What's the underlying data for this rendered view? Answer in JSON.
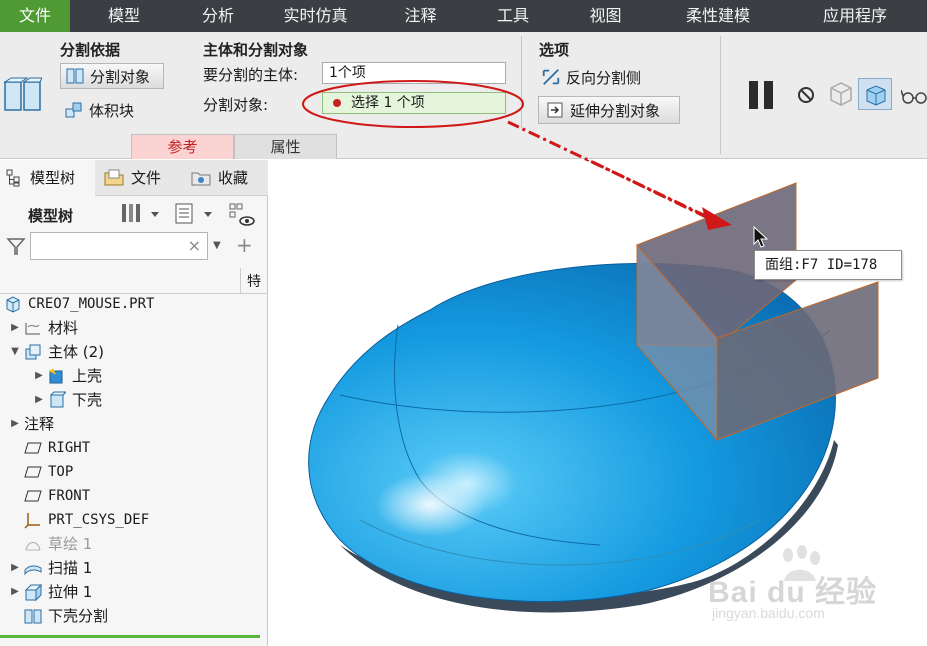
{
  "menu": [
    "文件",
    "模型",
    "分析",
    "实时仿真",
    "注释",
    "工具",
    "视图",
    "柔性建模",
    "应用程序"
  ],
  "ribbon": {
    "split_basis_title": "分割依据",
    "split_object_btn": "分割对象",
    "volume_block_btn": "体积块",
    "main_title": "主体和分割对象",
    "body_label": "要分割的主体:",
    "body_value": "1个项",
    "object_label": "分割对象:",
    "object_value": "选择 1 个项",
    "options_title": "选项",
    "reverse_side": "反向分割侧",
    "extend_object": "延伸分割对象",
    "tab_reference": "参考",
    "tab_properties": "属性"
  },
  "panel": {
    "tabs": [
      "模型树",
      "文件",
      "收藏"
    ],
    "tree_title": "模型树",
    "side_label": "特",
    "search_placeholder": "",
    "tree": [
      {
        "label": "CREO7_MOUSE.PRT",
        "icon": "part-icon",
        "indent": 0,
        "toggle": "",
        "mono": true,
        "dim": false
      },
      {
        "label": "材料",
        "icon": "material-icon",
        "indent": 1,
        "toggle": "▶",
        "mono": false,
        "dim": false
      },
      {
        "label": "主体 (2)",
        "icon": "bodies-icon",
        "indent": 1,
        "toggle": "▼",
        "mono": false,
        "dim": false
      },
      {
        "label": "上壳",
        "icon": "body-active-icon",
        "indent": 2,
        "toggle": "▶",
        "mono": false,
        "dim": false
      },
      {
        "label": "下壳",
        "icon": "body-icon",
        "indent": 2,
        "toggle": "▶",
        "mono": false,
        "dim": false
      },
      {
        "label": "注释",
        "icon": "",
        "indent": 1,
        "toggle": "▶",
        "mono": false,
        "dim": false
      },
      {
        "label": "RIGHT",
        "icon": "datum-plane-icon",
        "indent": 1,
        "toggle": "",
        "mono": true,
        "dim": false
      },
      {
        "label": "TOP",
        "icon": "datum-plane-icon",
        "indent": 1,
        "toggle": "",
        "mono": true,
        "dim": false
      },
      {
        "label": "FRONT",
        "icon": "datum-plane-icon",
        "indent": 1,
        "toggle": "",
        "mono": true,
        "dim": false
      },
      {
        "label": "PRT_CSYS_DEF",
        "icon": "csys-icon",
        "indent": 1,
        "toggle": "",
        "mono": true,
        "dim": false
      },
      {
        "label": "草绘 1",
        "icon": "sketch-icon",
        "indent": 1,
        "toggle": "",
        "mono": false,
        "dim": true
      },
      {
        "label": "扫描 1",
        "icon": "sweep-icon",
        "indent": 1,
        "toggle": "▶",
        "mono": false,
        "dim": false
      },
      {
        "label": "拉伸 1",
        "icon": "extrude-icon",
        "indent": 1,
        "toggle": "▶",
        "mono": false,
        "dim": false
      },
      {
        "label": "下壳分割",
        "icon": "split-icon",
        "indent": 1,
        "toggle": "",
        "mono": false,
        "dim": false
      }
    ]
  },
  "viewport": {
    "tooltip": "面组:F7 ID=178"
  },
  "watermark": {
    "brand": "Bai du 经验",
    "url": "jingyan.baidu.com"
  },
  "colors": {
    "menubar": "#3b3f44",
    "active_menu": "#4f9a32",
    "model_blue": "#1a9be0",
    "quilt_gray": "#6b6a78",
    "annotation_red": "#d01818"
  }
}
